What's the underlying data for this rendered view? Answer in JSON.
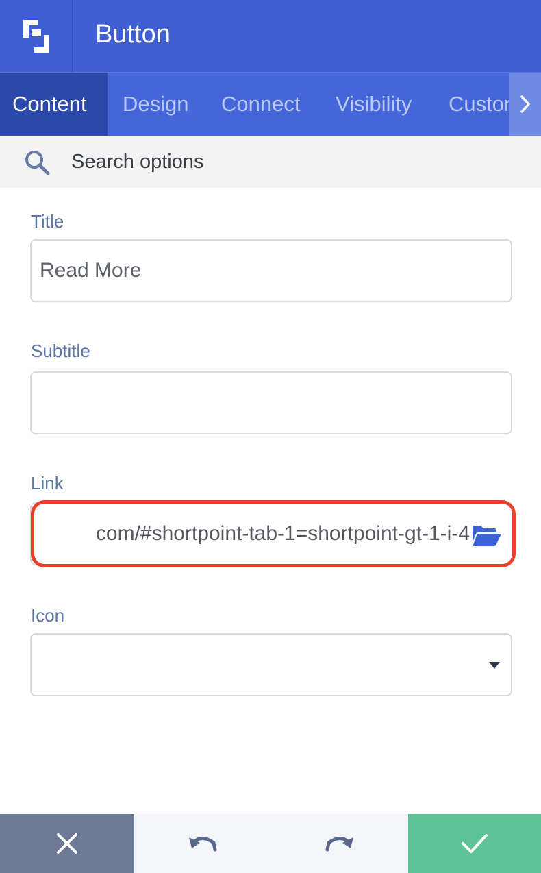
{
  "header": {
    "title": "Button",
    "logo_icon": "shortpoint-logo-icon",
    "background": "#3f5fd3"
  },
  "tabs": {
    "items": [
      {
        "label": "Content",
        "active": true
      },
      {
        "label": "Design",
        "active": false
      },
      {
        "label": "Connect",
        "active": false
      },
      {
        "label": "Visibility",
        "active": false
      },
      {
        "label": "Custor",
        "active": false
      }
    ],
    "scroll_icon": "chevron-right-icon"
  },
  "search": {
    "placeholder": "Search options",
    "icon": "search-icon"
  },
  "form": {
    "title_label": "Title",
    "title_value": "Read More",
    "subtitle_label": "Subtitle",
    "subtitle_value": "",
    "link_label": "Link",
    "link_value": "com/#shortpoint-tab-1=shortpoint-gt-1-i-4",
    "link_icon": "folder-open-icon",
    "icon_label": "Icon",
    "icon_value": "",
    "highlight_color": "#e8402d"
  },
  "footer": {
    "cancel_icon": "close-icon",
    "undo_icon": "undo-icon",
    "redo_icon": "redo-icon",
    "save_icon": "check-icon",
    "cancel_color": "#6e7a95",
    "save_color": "#5bc394"
  }
}
